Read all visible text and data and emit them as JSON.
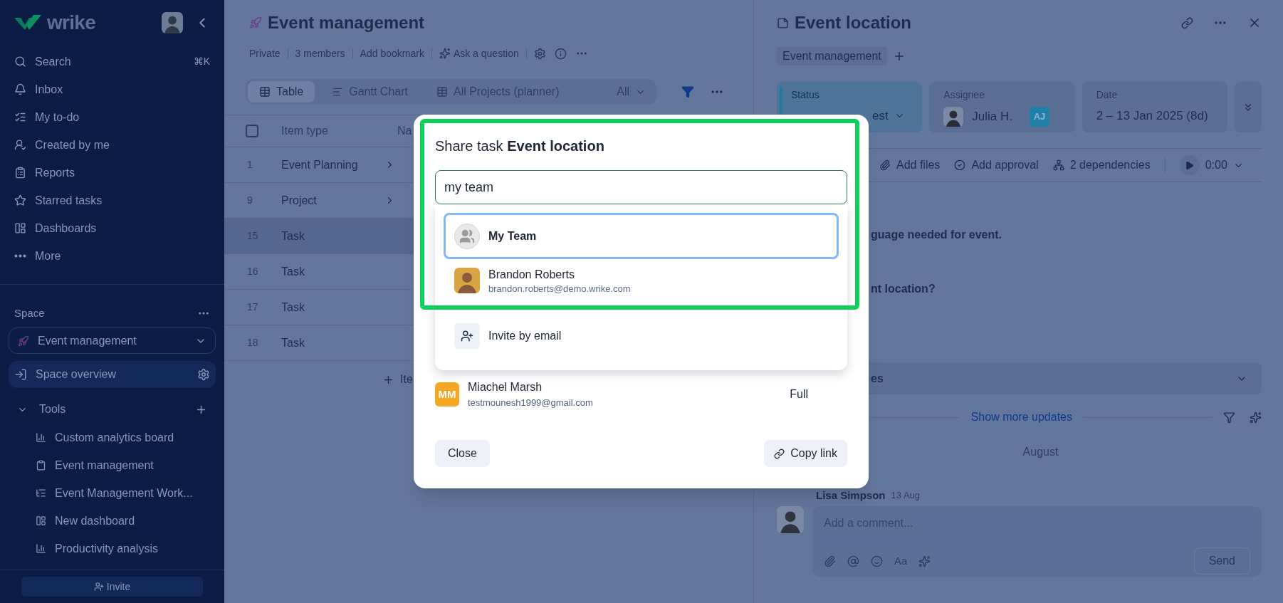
{
  "sidebar": {
    "logo": "wrike",
    "nav": [
      {
        "label": "Search",
        "shortcut": "⌘K"
      },
      {
        "label": "Inbox"
      },
      {
        "label": "My to-do"
      },
      {
        "label": "Created by me"
      },
      {
        "label": "Reports"
      },
      {
        "label": "Starred tasks"
      },
      {
        "label": "Dashboards"
      },
      {
        "label": "More"
      }
    ],
    "space": {
      "label": "Space",
      "selector": "Event management",
      "overview": {
        "label": "Space overview",
        "selected": true
      }
    },
    "tools": {
      "label": "Tools",
      "expanded": true,
      "items": [
        "Custom analytics board",
        "Event management",
        "Event Management Work...",
        "New dashboard",
        "Productivity analysis"
      ]
    },
    "invite": "Invite"
  },
  "project": {
    "title": "Event management",
    "meta": [
      "Private",
      "3 members",
      "Add bookmark",
      "Ask a question"
    ],
    "views": [
      {
        "label": "Table",
        "selected": true
      },
      {
        "label": "Gantt Chart",
        "selected": false
      },
      {
        "label": "All Projects (planner)",
        "selected": false
      }
    ],
    "view_filter": "All",
    "table": {
      "select_all": {
        "checked": false
      },
      "columns": [
        "Item type",
        "Na"
      ],
      "rows": [
        {
          "number": "1",
          "item_type": "Event Planning",
          "expandable": true,
          "selected": false
        },
        {
          "number": "9",
          "item_type": "Project",
          "expandable": true,
          "selected": false
        },
        {
          "number": "15",
          "item_type": "Task",
          "expandable": false,
          "selected": true
        },
        {
          "number": "16",
          "item_type": "Task",
          "expandable": false,
          "selected": false
        },
        {
          "number": "17",
          "item_type": "Task",
          "expandable": false,
          "selected": false
        },
        {
          "number": "18",
          "item_type": "Task",
          "expandable": false,
          "selected": false
        }
      ],
      "add_item": "Ite"
    }
  },
  "task": {
    "title": "Event location",
    "tag": "Event management",
    "fields": [
      {
        "kind": "status",
        "label": "Status",
        "value": "est"
      },
      {
        "kind": "assignee",
        "label": "Assignee",
        "value": "Julia H.",
        "badge": "AJ"
      },
      {
        "kind": "date",
        "label": "Date",
        "value": "2 – 13 Jan 2025 (8d)"
      }
    ],
    "actions": [
      "Add files",
      "Add approval",
      "2 dependencies"
    ],
    "timer": "0:00",
    "description": [
      "guage needed for event.",
      "nt location?"
    ],
    "section": "es",
    "show_more": "Show more updates",
    "month": "August",
    "update": {
      "author": "Lisa Simpson",
      "date": "13 Aug"
    },
    "comment": {
      "placeholder": "Add a comment...",
      "format": "Aa",
      "send": "Send"
    }
  },
  "share_dialog": {
    "title": "Share task **Event location**",
    "search": {
      "value": "my team"
    },
    "suggestions": [
      {
        "kind": "team",
        "name": "My Team",
        "selected": true
      },
      {
        "kind": "person",
        "name": "Brandon Roberts",
        "email": "brandon.roberts@demo.wrike.com",
        "selected": false
      },
      {
        "kind": "invite",
        "name": "Invite by email",
        "selected": false
      }
    ],
    "members": [
      {
        "initials": "MM",
        "name": "Miachel Marsh",
        "email": "testmounesh1999@gmail.com",
        "access": "Full"
      }
    ],
    "buttons": {
      "close": "Close",
      "copy_link": "Copy link"
    }
  }
}
